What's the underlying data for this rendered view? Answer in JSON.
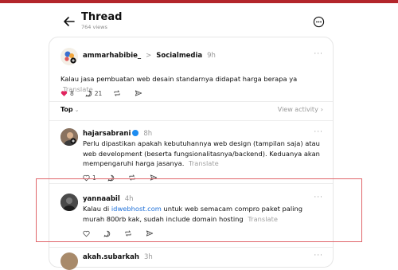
{
  "header": {
    "title": "Thread",
    "views": "764 views"
  },
  "main_post": {
    "username": "ammarhabibie_",
    "separator": ">",
    "community": "Socialmedia",
    "time": "9h",
    "text": "Kalau jasa pembuatan web desain standarnya didapat harga berapa ya",
    "translate": "Translate",
    "likes": "8",
    "replies": "21"
  },
  "sort": {
    "label": "Top",
    "view_activity": "View activity"
  },
  "replies": [
    {
      "username": "hajarsabrani",
      "time": "8h",
      "text": "Perlu dipastikan apakah kebutuhannya web design (tampilan saja) atau web development (beserta fungsionalitasnya/backend). Keduanya akan mempengaruhi harga jasanya.",
      "translate": "Translate",
      "likes": "1"
    },
    {
      "username": "yannaabil",
      "time": "4h",
      "text_before": "Kalau di ",
      "link": "idwebhost.com",
      "text_after": " untuk web semacam compro paket paling murah 800rb kak, sudah include domain hosting",
      "translate": "Translate"
    },
    {
      "username": "akah.subarkah",
      "time": "3h"
    }
  ],
  "colors": {
    "accent_bar": "#b3262b",
    "like_red": "#e0245e",
    "link_blue": "#1d6fd8",
    "highlight_border": "#e0666b"
  }
}
